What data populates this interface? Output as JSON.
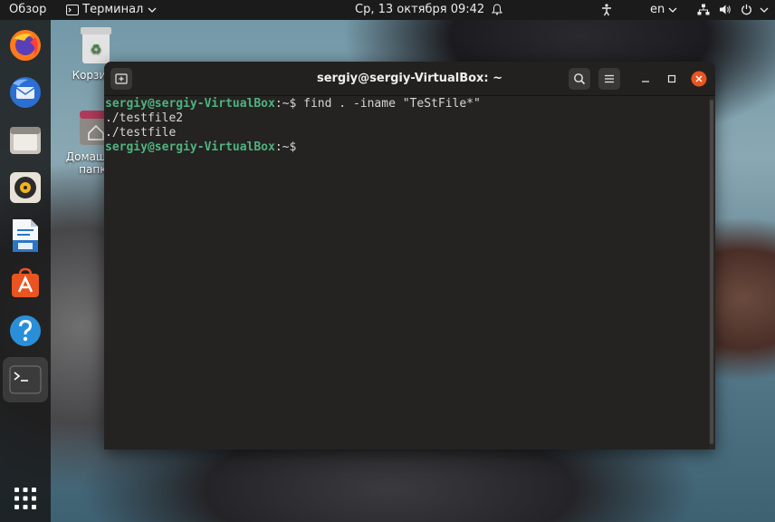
{
  "topbar": {
    "activities": "Обзор",
    "app_menu": "Терминал",
    "datetime": "Ср, 13 октября  09:42",
    "language": "en"
  },
  "desktop": {
    "trash_label": "Корзина",
    "home_label_line1": "Домашняя",
    "home_label_line2": "папка"
  },
  "dock": {
    "apps": [
      "firefox-icon",
      "thunderbird-icon",
      "files-icon",
      "rhythmbox-icon",
      "libreoffice-writer-icon",
      "software-center-icon",
      "help-icon",
      "terminal-icon"
    ],
    "show_apps": "show-applications-icon"
  },
  "terminal": {
    "title": "sergiy@sergiy-VirtualBox: ~",
    "lines": [
      {
        "user": "sergiy@sergiy-VirtualBox",
        "sep": ":~$ ",
        "cmd": "find . -iname \"TeStFile*\""
      },
      {
        "text": "./testfile2"
      },
      {
        "text": "./testfile"
      },
      {
        "user": "sergiy@sergiy-VirtualBox",
        "sep": ":~$ ",
        "cmd": ""
      }
    ]
  },
  "colors": {
    "prompt_user": "#4fb27f",
    "close_button": "#e95420",
    "topbar_bg": "#1b1b1b"
  }
}
